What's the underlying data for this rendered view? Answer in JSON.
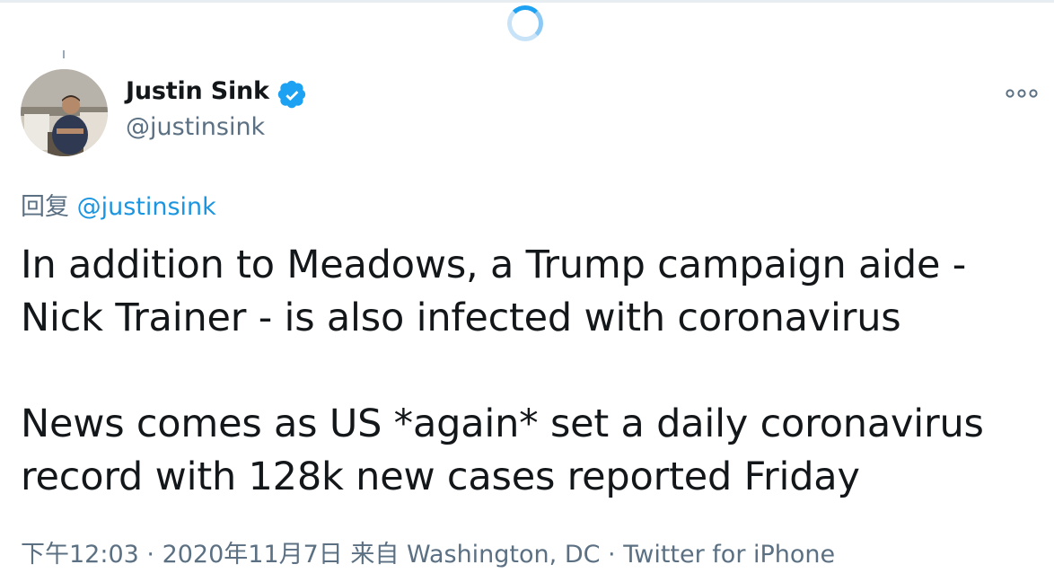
{
  "colors": {
    "brand_blue": "#1da1f2",
    "handle_gray": "#5b7083",
    "text_dark": "#14171a",
    "link_blue": "#1b95e0"
  },
  "loading": {
    "icon": "loading-spinner-icon"
  },
  "tweet": {
    "author": {
      "display_name": "Justin Sink",
      "handle": "@justinsink",
      "verified_icon": "verified-badge-icon",
      "avatar_icon": "profile-photo"
    },
    "more_icon": "more-options-icon",
    "reply_to": {
      "prefix": "回复",
      "handle": "@justinsink"
    },
    "text": {
      "p1_line1": "In addition to Meadows, a Trump campaign aide -",
      "p1_line2": "Nick Trainer - is also infected with coronavirus",
      "p2_line1": "News comes as US *again* set a daily coronavirus",
      "p2_line2": "record with 128k new cases reported Friday"
    },
    "meta": {
      "time": "下午12:03",
      "sep1": " · ",
      "date": "2020年11月7日",
      "from_prefix": " 来自 ",
      "location": "Washington, DC",
      "sep2": " · ",
      "source": "Twitter for iPhone"
    }
  }
}
